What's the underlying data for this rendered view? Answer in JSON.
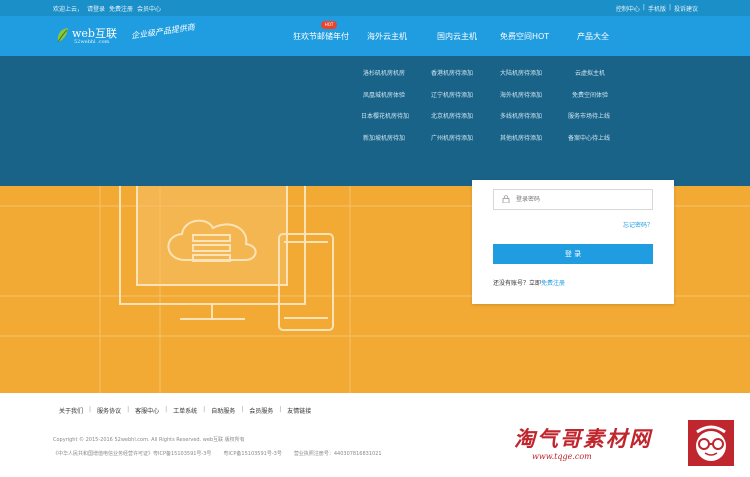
{
  "topbar": {
    "left": [
      "欢迎上云，",
      "请登录",
      "免费注册",
      "会员中心"
    ],
    "right": [
      "控制中心",
      "|",
      "手机版",
      "|",
      "投诉建议"
    ]
  },
  "logo": {
    "text": "web互联",
    "sub": "52webhl .com"
  },
  "slogan": "企业级产品提供商",
  "nav": {
    "hot_badge": "HOT",
    "items": [
      "狂欢节邮储年付",
      "海外云主机",
      "国内云主机",
      "免费空间HOT",
      "产品大全"
    ]
  },
  "mega_menu": {
    "rows": [
      [
        "洛杉矶机房机房",
        "香港机房待添加",
        "大陆机房待添加",
        "云虚拟主机"
      ],
      [
        "凤凰城机房体验",
        "辽宁机房待添加",
        "海外机房待添加",
        "免费空间体验"
      ],
      [
        "日本樱花机房待加",
        "北京机房待添加",
        "多线机房待添加",
        "服务市场待上线"
      ],
      [
        "新加坡机房待加",
        "广州机房待添加",
        "其他机房待添加",
        "备案中心待上线"
      ]
    ]
  },
  "login": {
    "password_placeholder": "登录密码",
    "forgot": "忘记密码？",
    "button": "登 录",
    "register_prompt": "还没有账号？立即",
    "register_link": "免费注册"
  },
  "footer": {
    "links": [
      "关于我们",
      "服务协议",
      "客服中心",
      "工单系统",
      "自助服务",
      "会员服务",
      "友情链接"
    ],
    "copyright": "Copyright © 2015-2016 52webhl.com. All Rights Reserved. web互联 版权所有",
    "icp": [
      "《中华人民共和国增值电信业务经营许可证》粤ICP备15103591号-3号",
      "粤ICP备15103591号-3号",
      "营业执照注册号：440307816831021"
    ]
  },
  "watermark": {
    "cn": "淘气哥素材网",
    "url": "www.tqge.com"
  },
  "colors": {
    "topbar": "#1b8fc8",
    "header": "#1f9de0",
    "mega": "#1a6388",
    "banner": "#f2aa34",
    "accent": "#1f9de0",
    "watermark": "#c0262d"
  }
}
